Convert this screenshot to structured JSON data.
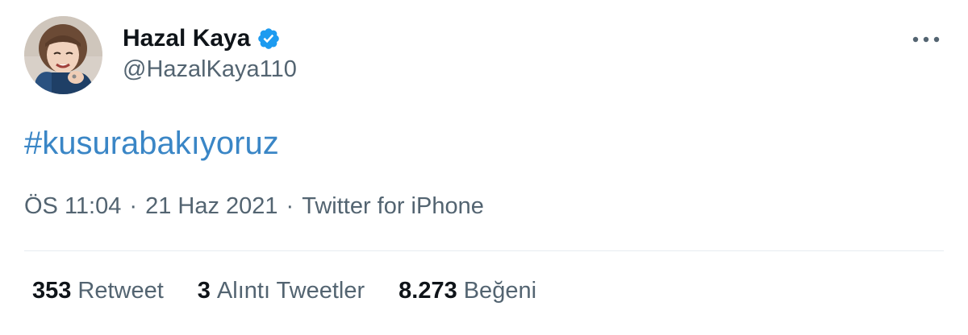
{
  "user": {
    "display_name": "Hazal Kaya",
    "handle": "@HazalKaya110",
    "verified": true
  },
  "tweet": {
    "text": "#kusurabakıyoruz"
  },
  "meta": {
    "time": "ÖS 11:04",
    "separator": "·",
    "date": "21 Haz 2021",
    "source": "Twitter for iPhone"
  },
  "stats": {
    "retweets": {
      "count": "353",
      "label": "Retweet"
    },
    "quotes": {
      "count": "3",
      "label": "Alıntı Tweetler"
    },
    "likes": {
      "count": "8.273",
      "label": "Beğeni"
    }
  },
  "colors": {
    "link": "#3a86c6",
    "verified": "#1d9bf0",
    "secondary_text": "#536471",
    "primary_text": "#0f1419"
  },
  "icons": {
    "verified": "verified-badge-icon",
    "more": "more-options-icon"
  }
}
